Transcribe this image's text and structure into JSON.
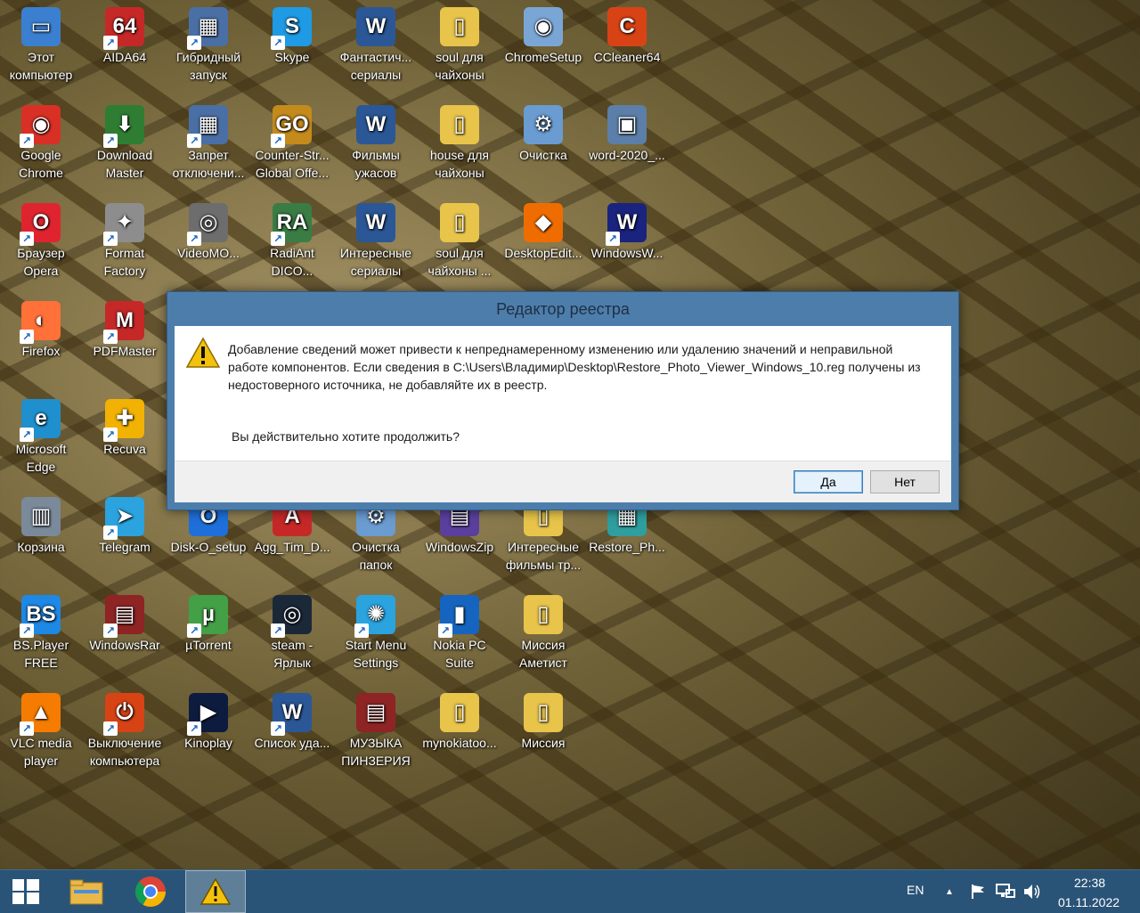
{
  "desktop": {
    "icons": [
      {
        "label": "Этот компьютер",
        "glyph": "▭",
        "color": "#3b7fd0",
        "short": false
      },
      {
        "label": "AIDA64",
        "glyph": "64",
        "color": "#c62828",
        "short": true
      },
      {
        "label": "Гибридный запуск",
        "glyph": "▦",
        "color": "#4a6fa5",
        "short": true
      },
      {
        "label": "Skype",
        "glyph": "S",
        "color": "#1e9be4",
        "short": true
      },
      {
        "label": "Фантастич... сериалы",
        "glyph": "W",
        "color": "#2b5797",
        "short": false
      },
      {
        "label": "soul для чайхоны",
        "glyph": "▯",
        "color": "#e8c44a",
        "short": false
      },
      {
        "label": "ChromeSetup",
        "glyph": "◉",
        "color": "#7aa6d6",
        "short": false
      },
      {
        "label": "CCleaner64",
        "glyph": "C",
        "color": "#d84315",
        "short": false
      },
      {
        "label": "Google Chrome",
        "glyph": "◉",
        "color": "#d93025",
        "short": true
      },
      {
        "label": "Download Master",
        "glyph": "⬇",
        "color": "#2e7d32",
        "short": true
      },
      {
        "label": "Запрет отключени...",
        "glyph": "▦",
        "color": "#4a6fa5",
        "short": true
      },
      {
        "label": "Counter-Str... Global Offe...",
        "glyph": "GO",
        "color": "#c48a1c",
        "short": true
      },
      {
        "label": "Фильмы ужасов",
        "glyph": "W",
        "color": "#2b5797",
        "short": false
      },
      {
        "label": "house для чайхоны",
        "glyph": "▯",
        "color": "#e8c44a",
        "short": false
      },
      {
        "label": "Очистка",
        "glyph": "⚙",
        "color": "#6a9bd1",
        "short": false
      },
      {
        "label": "word-2020_...",
        "glyph": "▣",
        "color": "#5b7fa8",
        "short": false
      },
      {
        "label": "Браузер Opera",
        "glyph": "O",
        "color": "#e0242f",
        "short": true
      },
      {
        "label": "Format Factory",
        "glyph": "✦",
        "color": "#8d8d8d",
        "short": true
      },
      {
        "label": "VideoMO...",
        "glyph": "◎",
        "color": "#6d6d6d",
        "short": true
      },
      {
        "label": "RadiAnt DICO...",
        "glyph": "RA",
        "color": "#3a7d44",
        "short": true
      },
      {
        "label": "Интересные сериалы",
        "glyph": "W",
        "color": "#2b5797",
        "short": false
      },
      {
        "label": "soul для чайхоны ...",
        "glyph": "▯",
        "color": "#e8c44a",
        "short": false
      },
      {
        "label": "DesktopEdit...",
        "glyph": "◆",
        "color": "#ef6c00",
        "short": false
      },
      {
        "label": "WindowsW...",
        "glyph": "W",
        "color": "#1a237e",
        "short": true
      },
      {
        "label": "Firefox",
        "glyph": "◐",
        "color": "#ff7139",
        "short": true
      },
      {
        "label": "PDFMaster",
        "glyph": "M",
        "color": "#c62828",
        "short": true
      },
      {
        "label": "Microsoft Edge",
        "glyph": "e",
        "color": "#1f8fce",
        "short": true
      },
      {
        "label": "Recuva",
        "glyph": "✚",
        "color": "#f2b203",
        "short": true
      },
      {
        "label": "Корзина",
        "glyph": "▥",
        "color": "#7a8a9a",
        "short": false
      },
      {
        "label": "Telegram",
        "glyph": "➤",
        "color": "#2aa3df",
        "short": true
      },
      {
        "label": "Disk-O_setup",
        "glyph": "O",
        "color": "#1e6fd9",
        "short": false
      },
      {
        "label": "Agg_Tim_D...",
        "glyph": "A",
        "color": "#c62828",
        "short": false
      },
      {
        "label": "Очистка папок",
        "glyph": "⚙",
        "color": "#6a9bd1",
        "short": false
      },
      {
        "label": "WindowsZip",
        "glyph": "▤",
        "color": "#5b3f9e",
        "short": false
      },
      {
        "label": "Интересные фильмы тр...",
        "glyph": "▯",
        "color": "#e8c44a",
        "short": false
      },
      {
        "label": "Restore_Ph...",
        "glyph": "▦",
        "color": "#2e9e9e",
        "short": false
      },
      {
        "label": "BS.Player FREE",
        "glyph": "BS",
        "color": "#1e88e5",
        "short": true
      },
      {
        "label": "WindowsRar",
        "glyph": "▤",
        "color": "#8e2424",
        "short": true
      },
      {
        "label": "µTorrent",
        "glyph": "µ",
        "color": "#43a047",
        "short": true
      },
      {
        "label": "steam - Ярлык",
        "glyph": "◎",
        "color": "#1b2838",
        "short": true
      },
      {
        "label": "Start Menu Settings",
        "glyph": "✺",
        "color": "#2aa3df",
        "short": true
      },
      {
        "label": "Nokia PC Suite",
        "glyph": "▮",
        "color": "#1565c0",
        "short": true
      },
      {
        "label": "Миссия Аметист",
        "glyph": "▯",
        "color": "#e8c44a",
        "short": false
      },
      {
        "label": "VLC media player",
        "glyph": "▲",
        "color": "#f57c00",
        "short": true
      },
      {
        "label": "Выключение компьютера",
        "glyph": "⏻",
        "color": "#d84315",
        "short": true
      },
      {
        "label": "Kinoplay",
        "glyph": "▶",
        "color": "#0d1b3e",
        "short": true
      },
      {
        "label": "Список уда...",
        "glyph": "W",
        "color": "#2b5797",
        "short": true
      },
      {
        "label": "МУЗЫКА ПИНЗЕРИЯ",
        "glyph": "▤",
        "color": "#8e2424",
        "short": false
      },
      {
        "label": "mynokiatoo...",
        "glyph": "▯",
        "color": "#e8c44a",
        "short": false
      },
      {
        "label": "Миссия",
        "glyph": "▯",
        "color": "#e8c44a",
        "short": false
      }
    ]
  },
  "dialog": {
    "title": "Редактор реестра",
    "message_line1": "Добавление сведений может привести к непреднамеренному изменению или удалению значений и неправильной работе компонентов. Если сведения в C:\\Users\\Владимир\\Desktop\\Restore_Photo_Viewer_Windows_10.reg получены из недостоверного источника, не добавляйте их в реестр.",
    "question": "Вы действительно хотите продолжить?",
    "yes_label": "Да",
    "no_label": "Нет",
    "icon": "warning-icon"
  },
  "taskbar": {
    "language": "EN",
    "time": "22:38",
    "date": "01.11.2022",
    "pinned": [
      "start-icon",
      "file-explorer-icon",
      "chrome-icon",
      "regedit-warning-icon"
    ]
  }
}
